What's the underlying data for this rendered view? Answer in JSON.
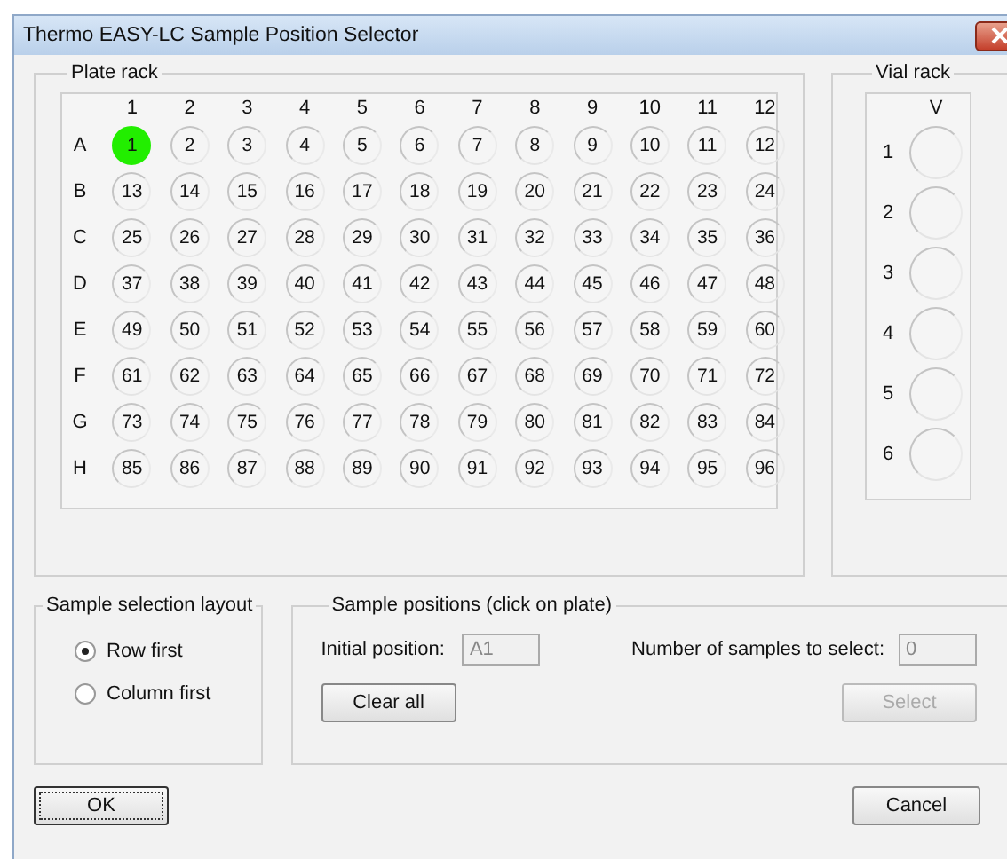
{
  "window": {
    "title": "Thermo EASY-LC Sample Position Selector"
  },
  "plate_rack": {
    "legend": "Plate rack",
    "columns": [
      "1",
      "2",
      "3",
      "4",
      "5",
      "6",
      "7",
      "8",
      "9",
      "10",
      "11",
      "12"
    ],
    "rows": [
      {
        "label": "A",
        "wells": [
          {
            "label": "1",
            "selected": true
          },
          {
            "label": "2",
            "selected": false
          },
          {
            "label": "3",
            "selected": false
          },
          {
            "label": "4",
            "selected": false
          },
          {
            "label": "5",
            "selected": false
          },
          {
            "label": "6",
            "selected": false
          },
          {
            "label": "7",
            "selected": false
          },
          {
            "label": "8",
            "selected": false
          },
          {
            "label": "9",
            "selected": false
          },
          {
            "label": "10",
            "selected": false
          },
          {
            "label": "11",
            "selected": false
          },
          {
            "label": "12",
            "selected": false
          }
        ]
      },
      {
        "label": "B",
        "wells": [
          {
            "label": "13",
            "selected": false
          },
          {
            "label": "14",
            "selected": false
          },
          {
            "label": "15",
            "selected": false
          },
          {
            "label": "16",
            "selected": false
          },
          {
            "label": "17",
            "selected": false
          },
          {
            "label": "18",
            "selected": false
          },
          {
            "label": "19",
            "selected": false
          },
          {
            "label": "20",
            "selected": false
          },
          {
            "label": "21",
            "selected": false
          },
          {
            "label": "22",
            "selected": false
          },
          {
            "label": "23",
            "selected": false
          },
          {
            "label": "24",
            "selected": false
          }
        ]
      },
      {
        "label": "C",
        "wells": [
          {
            "label": "25",
            "selected": false
          },
          {
            "label": "26",
            "selected": false
          },
          {
            "label": "27",
            "selected": false
          },
          {
            "label": "28",
            "selected": false
          },
          {
            "label": "29",
            "selected": false
          },
          {
            "label": "30",
            "selected": false
          },
          {
            "label": "31",
            "selected": false
          },
          {
            "label": "32",
            "selected": false
          },
          {
            "label": "33",
            "selected": false
          },
          {
            "label": "34",
            "selected": false
          },
          {
            "label": "35",
            "selected": false
          },
          {
            "label": "36",
            "selected": false
          }
        ]
      },
      {
        "label": "D",
        "wells": [
          {
            "label": "37",
            "selected": false
          },
          {
            "label": "38",
            "selected": false
          },
          {
            "label": "39",
            "selected": false
          },
          {
            "label": "40",
            "selected": false
          },
          {
            "label": "41",
            "selected": false
          },
          {
            "label": "42",
            "selected": false
          },
          {
            "label": "43",
            "selected": false
          },
          {
            "label": "44",
            "selected": false
          },
          {
            "label": "45",
            "selected": false
          },
          {
            "label": "46",
            "selected": false
          },
          {
            "label": "47",
            "selected": false
          },
          {
            "label": "48",
            "selected": false
          }
        ]
      },
      {
        "label": "E",
        "wells": [
          {
            "label": "49",
            "selected": false
          },
          {
            "label": "50",
            "selected": false
          },
          {
            "label": "51",
            "selected": false
          },
          {
            "label": "52",
            "selected": false
          },
          {
            "label": "53",
            "selected": false
          },
          {
            "label": "54",
            "selected": false
          },
          {
            "label": "55",
            "selected": false
          },
          {
            "label": "56",
            "selected": false
          },
          {
            "label": "57",
            "selected": false
          },
          {
            "label": "58",
            "selected": false
          },
          {
            "label": "59",
            "selected": false
          },
          {
            "label": "60",
            "selected": false
          }
        ]
      },
      {
        "label": "F",
        "wells": [
          {
            "label": "61",
            "selected": false
          },
          {
            "label": "62",
            "selected": false
          },
          {
            "label": "63",
            "selected": false
          },
          {
            "label": "64",
            "selected": false
          },
          {
            "label": "65",
            "selected": false
          },
          {
            "label": "66",
            "selected": false
          },
          {
            "label": "67",
            "selected": false
          },
          {
            "label": "68",
            "selected": false
          },
          {
            "label": "69",
            "selected": false
          },
          {
            "label": "70",
            "selected": false
          },
          {
            "label": "71",
            "selected": false
          },
          {
            "label": "72",
            "selected": false
          }
        ]
      },
      {
        "label": "G",
        "wells": [
          {
            "label": "73",
            "selected": false
          },
          {
            "label": "74",
            "selected": false
          },
          {
            "label": "75",
            "selected": false
          },
          {
            "label": "76",
            "selected": false
          },
          {
            "label": "77",
            "selected": false
          },
          {
            "label": "78",
            "selected": false
          },
          {
            "label": "79",
            "selected": false
          },
          {
            "label": "80",
            "selected": false
          },
          {
            "label": "81",
            "selected": false
          },
          {
            "label": "82",
            "selected": false
          },
          {
            "label": "83",
            "selected": false
          },
          {
            "label": "84",
            "selected": false
          }
        ]
      },
      {
        "label": "H",
        "wells": [
          {
            "label": "85",
            "selected": false
          },
          {
            "label": "86",
            "selected": false
          },
          {
            "label": "87",
            "selected": false
          },
          {
            "label": "88",
            "selected": false
          },
          {
            "label": "89",
            "selected": false
          },
          {
            "label": "90",
            "selected": false
          },
          {
            "label": "91",
            "selected": false
          },
          {
            "label": "92",
            "selected": false
          },
          {
            "label": "93",
            "selected": false
          },
          {
            "label": "94",
            "selected": false
          },
          {
            "label": "95",
            "selected": false
          },
          {
            "label": "96",
            "selected": false
          }
        ]
      }
    ]
  },
  "vial_rack": {
    "legend": "Vial rack",
    "column": "V",
    "rows": [
      {
        "label": "1",
        "selected": false
      },
      {
        "label": "2",
        "selected": false
      },
      {
        "label": "3",
        "selected": false
      },
      {
        "label": "4",
        "selected": false
      },
      {
        "label": "5",
        "selected": false
      },
      {
        "label": "6",
        "selected": false
      }
    ]
  },
  "sample_selection_layout": {
    "legend": "Sample selection layout",
    "options": [
      {
        "label": "Row first",
        "selected": true
      },
      {
        "label": "Column first",
        "selected": false
      }
    ]
  },
  "sample_positions": {
    "legend": "Sample positions  (click on plate)",
    "initial_position": {
      "label": "Initial position:",
      "value": "A1",
      "disabled": true
    },
    "number_of_samples": {
      "label": "Number of samples to select:",
      "value": "0",
      "disabled": true
    },
    "clear_button": {
      "label": "Clear all",
      "disabled": false
    },
    "select_button": {
      "label": "Select",
      "disabled": true
    }
  },
  "buttons": {
    "ok": "OK",
    "cancel": "Cancel"
  }
}
